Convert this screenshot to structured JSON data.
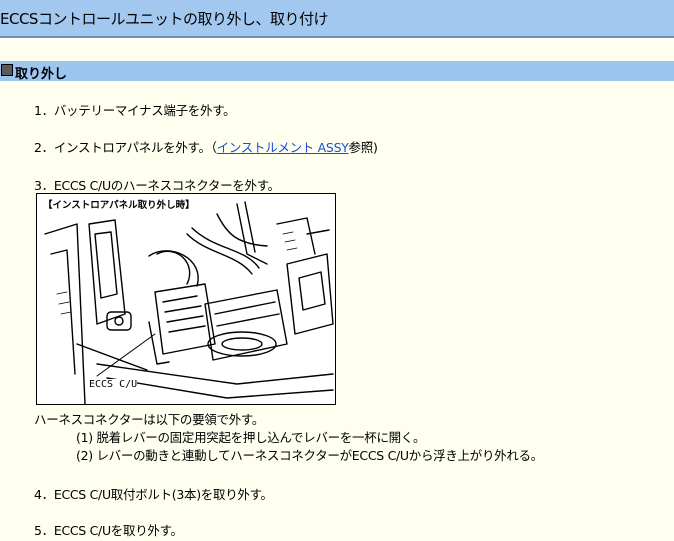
{
  "header": {
    "title": "ECCSコントロールユニットの取り外し、取り付け"
  },
  "section": {
    "title": "取り外し",
    "icon": "square-bullet-icon"
  },
  "steps": [
    {
      "text": "1．バッテリーマイナス端子を外す。"
    },
    {
      "prefix": "2．インストロアパネルを外す。（",
      "link": "インストルメント ASSY",
      "suffix": "参照)"
    },
    {
      "text": "3．ECCS C/Uのハーネスコネクターを外す。"
    },
    {
      "text": "4．ECCS C/U取付ボルト(3本)を取り外す。"
    },
    {
      "text": "5．ECCS C/Uを取り外す。"
    }
  ],
  "figure": {
    "label": "【インストロアパネル取り外し時】",
    "caption": "ECCS C/U"
  },
  "notes": {
    "intro": "ハーネスコネクターは以下の要領で外す。",
    "items": [
      "(1) 脱着レバーの固定用突起を押し込んでレバーを一杯に開く。",
      "(2) レバーの動きと連動してハーネスコネクターがECCS C/Uから浮き上がり外れる。"
    ]
  },
  "colors": {
    "background": "#fffff0",
    "title_bar": "#a3c8f0",
    "section_bar": "#9cc5f0",
    "link": "#1a4ed8"
  }
}
